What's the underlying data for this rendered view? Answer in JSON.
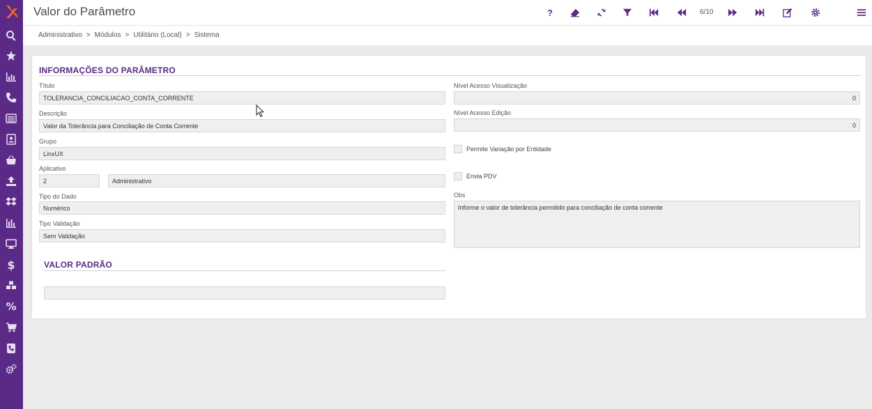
{
  "header": {
    "title": "Valor do Parâmetro",
    "help_label": "?",
    "pager": "6/10"
  },
  "breadcrumb": [
    "Administrativo",
    "Módulos",
    "Utilitário (Local)",
    "Sistema"
  ],
  "breadcrumb_sep": ">",
  "sidebar": {
    "items": [
      "search-icon",
      "star-icon",
      "chart-icon",
      "phone-icon",
      "list-icon",
      "contact-icon",
      "basket-icon",
      "upload-icon",
      "dropbox-icon",
      "bar-chart-icon",
      "monitor-icon",
      "dollar-icon",
      "cubes-icon",
      "percent-icon",
      "cart-icon",
      "phone-book-icon",
      "cogs-icon"
    ]
  },
  "form": {
    "section_title": "INFORMAÇÕES DO PARÂMETRO",
    "titulo_label": "Título",
    "titulo_value": "TOLERANCIA_CONCILIACAO_CONTA_CORRENTE",
    "descricao_label": "Descrição",
    "descricao_value": "Valor da Tolerância para Conciliação de Conta Corrente",
    "grupo_label": "Grupo",
    "grupo_value": "LinxUX",
    "aplicativo_label": "Aplicativo",
    "aplicativo_code": "2",
    "aplicativo_name": "Administrativo",
    "tipo_dado_label": "Tipo do Dado",
    "tipo_dado_value": "Numérico",
    "tipo_validacao_label": "Tipo Validação",
    "tipo_validacao_value": "Sem Validação",
    "nivel_vis_label": "Nível Acesso Visualização",
    "nivel_vis_value": "0",
    "nivel_edicao_label": "Nível Acesso Edição",
    "nivel_edicao_value": "0",
    "permite_variacao_label": "Permite Variação por Entidade",
    "envia_pdv_label": "Envia PDV",
    "obs_label": "Obs",
    "obs_value": "Informe o valor de tolerância permitido para conciliação de conta corrente"
  },
  "valor_padrao": {
    "section_title": "VALOR PADRÃO",
    "value": ""
  },
  "colors": {
    "accent": "#5b2a86",
    "sidebar_bg": "#5b2a86",
    "logo": "#f26a21"
  }
}
